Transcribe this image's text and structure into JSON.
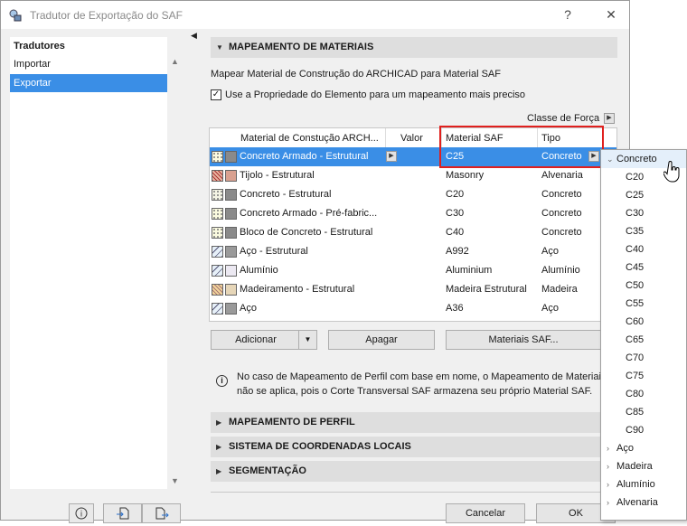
{
  "window": {
    "title": "Tradutor de Exportação do SAF",
    "help": "?",
    "close": "✕"
  },
  "left": {
    "header": "Tradutores",
    "items": [
      "Importar",
      "Exportar"
    ],
    "selected": 1
  },
  "section_material": {
    "title": "MAPEAMENTO DE MATERIAIS",
    "description": "Mapear Material de Construção do ARCHICAD para Material SAF",
    "checkbox_label": "Use a Propriedade do Elemento para um mapeamento mais preciso",
    "checkbox_checked": true,
    "classe_label": "Classe de Força"
  },
  "table": {
    "headers": [
      "Material de Constução ARCH...",
      "Valor",
      "Material SAF",
      "Tipo"
    ],
    "rows": [
      {
        "name": "Concreto Armado - Estrutural",
        "saf": "C25",
        "tipo": "Concreto",
        "icon": "concrete-pattern",
        "selected": true
      },
      {
        "name": "Tijolo - Estrutural",
        "saf": "Masonry",
        "tipo": "Alvenaria",
        "icon": "brick-pattern"
      },
      {
        "name": "Concreto - Estrutural",
        "saf": "C20",
        "tipo": "Concreto",
        "icon": "concrete-pattern"
      },
      {
        "name": "Concreto Armado - Pré-fabric...",
        "saf": "C30",
        "tipo": "Concreto",
        "icon": "concrete-pattern"
      },
      {
        "name": "Bloco de Concreto - Estrutural",
        "saf": "C40",
        "tipo": "Concreto",
        "icon": "concrete-pattern"
      },
      {
        "name": "Aço - Estrutural",
        "saf": "A992",
        "tipo": "Aço",
        "icon": "steel-pattern"
      },
      {
        "name": "Alumínio",
        "saf": "Aluminium",
        "tipo": "Alumínio",
        "icon": "aluminium-pattern"
      },
      {
        "name": "Madeiramento - Estrutural",
        "saf": "Madeira Estrutural",
        "tipo": "Madeira",
        "icon": "wood-pattern"
      },
      {
        "name": "Aço",
        "saf": "A36",
        "tipo": "Aço",
        "icon": "steel-pattern"
      }
    ]
  },
  "buttons": {
    "adicionar": "Adicionar",
    "apagar": "Apagar",
    "materiais": "Materiais SAF...",
    "cancelar": "Cancelar",
    "ok": "OK"
  },
  "info": {
    "text": "No caso de Mapeamento de Perfil com base em nome, o Mapeamento de Materiais não se aplica, pois o Corte Transversal SAF armazena seu próprio Material SAF."
  },
  "sections": [
    "MAPEAMENTO DE PERFIL",
    "SISTEMA DE COORDENADAS LOCAIS",
    "SEGMENTAÇÃO"
  ],
  "dropdown": {
    "expanded_group": "Concreto",
    "concrete_items": [
      "C20",
      "C25",
      "C30",
      "C35",
      "C40",
      "C45",
      "C50",
      "C55",
      "C60",
      "C65",
      "C70",
      "C75",
      "C80",
      "C85",
      "C90"
    ],
    "collapsed_groups": [
      "Aço",
      "Madeira",
      "Alumínio",
      "Alvenaria"
    ]
  },
  "colors": {
    "selection": "#3a8ee6",
    "highlight": "#e0201e",
    "section_bg": "#dedede"
  }
}
